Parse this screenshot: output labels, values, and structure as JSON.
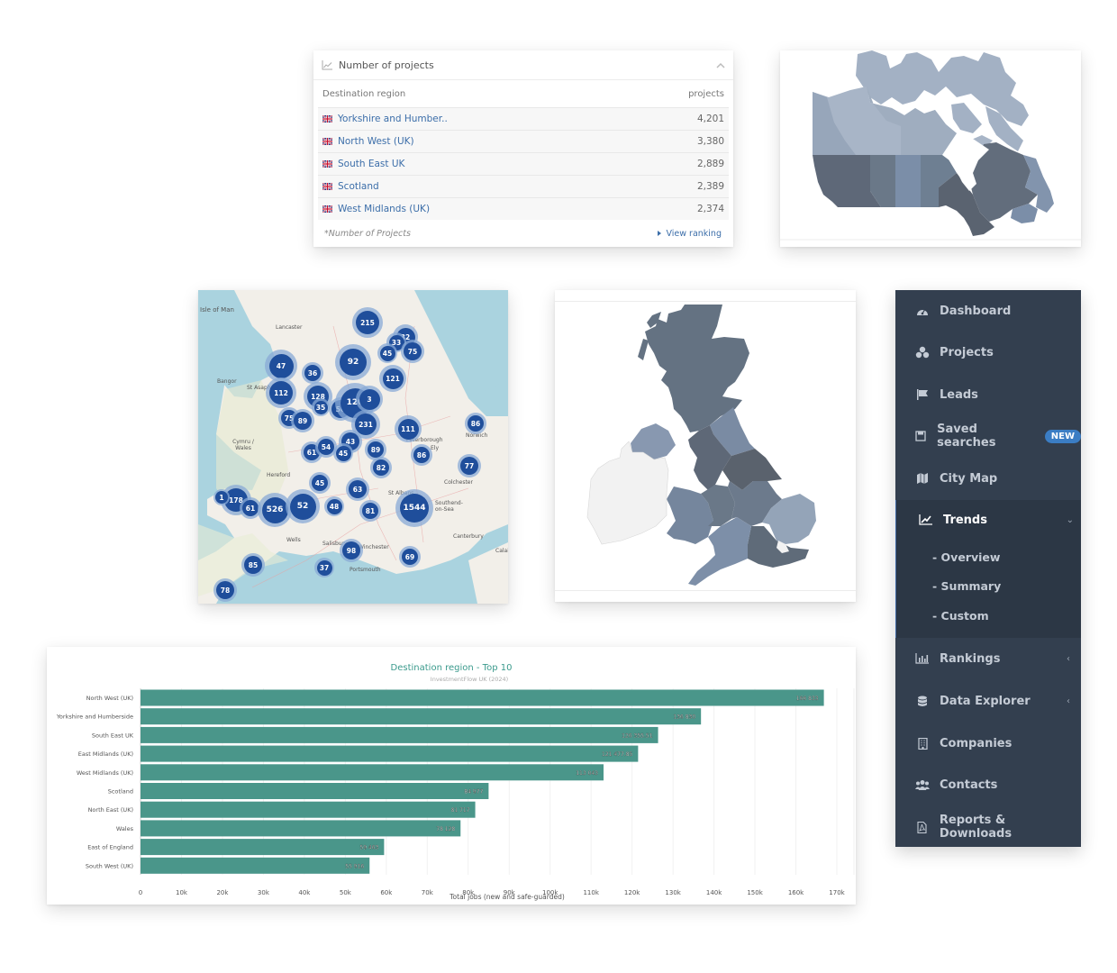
{
  "projects_widget": {
    "title": "Number of projects",
    "icon": "line-chart-icon",
    "collapse_icon": "chevron-up-icon",
    "column_headers": [
      "Destination region",
      "projects"
    ],
    "rows": [
      {
        "flag": "uk-flag-icon",
        "region": "Yorkshire and Humber..",
        "projects": "4,201"
      },
      {
        "flag": "uk-flag-icon",
        "region": "North West (UK)",
        "projects": "3,380"
      },
      {
        "flag": "uk-flag-icon",
        "region": "South East UK",
        "projects": "2,889"
      },
      {
        "flag": "uk-flag-icon",
        "region": "Scotland",
        "projects": "2,389"
      },
      {
        "flag": "uk-flag-icon",
        "region": "West Midlands (UK)",
        "projects": "2,374"
      }
    ],
    "footnote": "*Number of Projects",
    "view_ranking_label": "View ranking"
  },
  "canada_map": {
    "description": "Canada provinces choropleth",
    "colors": {
      "light": "#a3b1c4",
      "mid": "#6f7f93",
      "dark": "#5b6573",
      "accent": "#7f93b0"
    }
  },
  "cluster_map": {
    "place_labels": [
      "Isle of Man",
      "Bangor",
      "St Asaph",
      "Cymru / Wales",
      "Hereford",
      "Wells",
      "Salisbury",
      "Winchester",
      "Portsmouth",
      "Colchester",
      "Southend-on-Sea",
      "Canterbury",
      "Calais",
      "Norwich",
      "Peterborough",
      "St Albans",
      "Lancaster",
      "Ely"
    ],
    "clusters": [
      {
        "label": "215"
      },
      {
        "label": "32"
      },
      {
        "label": "33"
      },
      {
        "label": "45"
      },
      {
        "label": "75"
      },
      {
        "label": "47"
      },
      {
        "label": "92"
      },
      {
        "label": "36"
      },
      {
        "label": "121"
      },
      {
        "label": "112"
      },
      {
        "label": "128"
      },
      {
        "label": "35"
      },
      {
        "label": "56"
      },
      {
        "label": "120"
      },
      {
        "label": "3"
      },
      {
        "label": "75"
      },
      {
        "label": "89"
      },
      {
        "label": "231"
      },
      {
        "label": "111"
      },
      {
        "label": "86"
      },
      {
        "label": "61"
      },
      {
        "label": "54"
      },
      {
        "label": "43"
      },
      {
        "label": "45"
      },
      {
        "label": "89"
      },
      {
        "label": "86"
      },
      {
        "label": "82"
      },
      {
        "label": "77"
      },
      {
        "label": "45"
      },
      {
        "label": "178"
      },
      {
        "label": "61"
      },
      {
        "label": "526"
      },
      {
        "label": "52"
      },
      {
        "label": "48"
      },
      {
        "label": "63"
      },
      {
        "label": "81"
      },
      {
        "label": "1544"
      },
      {
        "label": "98"
      },
      {
        "label": "85"
      },
      {
        "label": "37"
      },
      {
        "label": "69"
      },
      {
        "label": "78"
      },
      {
        "label": "1"
      }
    ],
    "cluster_color": "#1f4e9b"
  },
  "uk_map": {
    "description": "UK regions choropleth",
    "colors": {
      "scotland": "#647282",
      "north_east": "#7a8ba3",
      "north_west": "#5e6877",
      "yorkshire": "#5a626d",
      "wales": "#75869d",
      "west_midlands": "#6a7888",
      "east_midlands": "#6c7a8c",
      "east": "#94a4b8",
      "south_east": "#5f6b79",
      "south_west": "#7d8fa8",
      "northern_ireland": "#8898b0",
      "ireland": "#f2f2f2"
    }
  },
  "sidebar": {
    "items": [
      {
        "label": "Dashboard",
        "icon": "dashboard-icon"
      },
      {
        "label": "Projects",
        "icon": "projects-icon"
      },
      {
        "label": "Leads",
        "icon": "flag-icon"
      },
      {
        "label": "Saved searches",
        "icon": "save-icon",
        "badge": "NEW"
      },
      {
        "label": "City Map",
        "icon": "map-icon"
      },
      {
        "label": "Trends",
        "icon": "trend-icon",
        "expanded": true
      },
      {
        "label": "Rankings",
        "icon": "bar-chart-icon"
      },
      {
        "label": "Data Explorer",
        "icon": "database-icon"
      },
      {
        "label": "Companies",
        "icon": "building-icon"
      },
      {
        "label": "Contacts",
        "icon": "users-icon"
      },
      {
        "label": "Reports & Downloads",
        "icon": "pdf-icon"
      }
    ],
    "trends_sub": [
      "- Overview",
      "- Summary",
      "- Custom"
    ],
    "active": "Trends"
  },
  "chart_data": {
    "type": "bar",
    "orientation": "horizontal",
    "title": "Destination region - Top 10",
    "subtitle": "InvestmentFlow UK (2024)",
    "xlabel": "Total jobs (new and safe-guarded)",
    "ylabel": "",
    "categories": [
      "North West (UK)",
      "Yorkshire and Humberside",
      "South East UK",
      "East Midlands (UK)",
      "West Midlands (UK)",
      "Scotland",
      "North East (UK)",
      "Wales",
      "East of England",
      "South West (UK)"
    ],
    "values": [
      166833,
      136830,
      126355.51,
      121477.85,
      113043,
      84977,
      81717,
      78128,
      59463,
      55916
    ],
    "value_labels": [
      "166 833",
      "136 830",
      "126 355.51",
      "121 477.85",
      "113 043",
      "84 977",
      "81 717",
      "78 128",
      "59 463",
      "55 916"
    ],
    "xlim": [
      0,
      175000
    ],
    "xticks": [
      0,
      10000,
      20000,
      30000,
      40000,
      50000,
      60000,
      70000,
      80000,
      90000,
      100000,
      110000,
      120000,
      130000,
      140000,
      150000,
      160000,
      170000
    ],
    "xtick_labels": [
      "0",
      "10k",
      "20k",
      "30k",
      "40k",
      "50k",
      "60k",
      "70k",
      "80k",
      "90k",
      "100k",
      "110k",
      "120k",
      "130k",
      "140k",
      "150k",
      "160k",
      "170k"
    ],
    "bar_color": "#4a968a",
    "title_color": "#3a9a8c",
    "grid": true
  }
}
